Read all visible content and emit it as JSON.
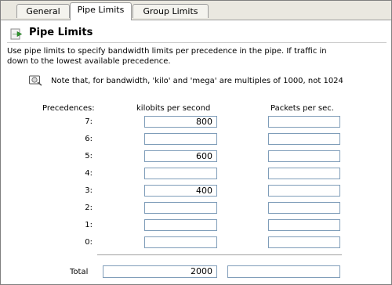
{
  "tabs": [
    {
      "label": "General"
    },
    {
      "label": "Pipe Limits"
    },
    {
      "label": "Group Limits"
    }
  ],
  "section": {
    "title": "Pipe Limits",
    "description_line1": "Use pipe limits to specify bandwidth limits per precedence in the pipe. If traffic in",
    "description_line2": "down to the lowest available precedence.",
    "note": "Note that, for bandwidth, 'kilo' and 'mega' are multiples of 1000, not 1024"
  },
  "table": {
    "col_precedences": "Precedences:",
    "col_kbps": "kilobits per second",
    "col_pps": "Packets per sec.",
    "rows": [
      {
        "label": "7:",
        "kbps": "800",
        "pps": ""
      },
      {
        "label": "6:",
        "kbps": "",
        "pps": ""
      },
      {
        "label": "5:",
        "kbps": "600",
        "pps": ""
      },
      {
        "label": "4:",
        "kbps": "",
        "pps": ""
      },
      {
        "label": "3:",
        "kbps": "400",
        "pps": ""
      },
      {
        "label": "2:",
        "kbps": "",
        "pps": ""
      },
      {
        "label": "1:",
        "kbps": "",
        "pps": ""
      },
      {
        "label": "0:",
        "kbps": "",
        "pps": ""
      }
    ],
    "total_label": "Total",
    "total_kbps": "2000",
    "total_pps": ""
  },
  "colors": {
    "accent_arrow": "#2e9a2e",
    "field_border": "#7f9db9"
  }
}
